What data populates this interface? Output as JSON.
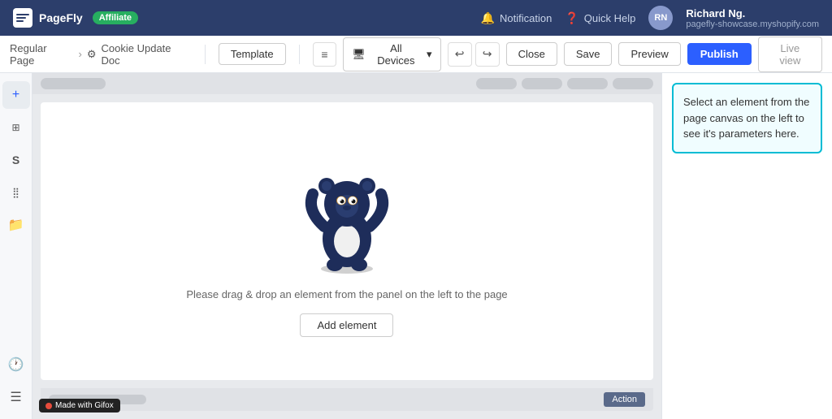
{
  "topNav": {
    "logo": "PageFly",
    "badge": "Affiliate",
    "notification": "Notification",
    "quickHelp": "Quick Help",
    "user": {
      "name": "Richard Ng.",
      "shop": "pagefly-showcase.myshopify.com",
      "initials": "RN"
    }
  },
  "toolbar": {
    "breadcrumb": {
      "page": "Regular Page",
      "separator": "›",
      "docName": "Cookie Update Doc"
    },
    "template": "Template",
    "allDevices": "All Devices",
    "close": "Close",
    "save": "Save",
    "preview": "Preview",
    "publish": "Publish",
    "livePreview": "Live view"
  },
  "sidebar": {
    "icons": [
      {
        "name": "plus-icon",
        "symbol": "+"
      },
      {
        "name": "grid-icon",
        "symbol": "⊞"
      },
      {
        "name": "shopify-icon",
        "symbol": "S"
      },
      {
        "name": "apps-icon",
        "symbol": "⋮⋮"
      },
      {
        "name": "folder-icon",
        "symbol": "🗂"
      }
    ],
    "bottomIcons": [
      {
        "name": "history-icon",
        "symbol": "🕐"
      },
      {
        "name": "list-icon",
        "symbol": "≡"
      }
    ]
  },
  "canvas": {
    "dropText": "Please drag & drop an element from the panel on the left to the page",
    "addElement": "Add element"
  },
  "rightPanel": {
    "infoText": "Select an element from the page canvas on the left to see it's parameters here."
  },
  "gifox": {
    "label": "Made with Gifox"
  }
}
